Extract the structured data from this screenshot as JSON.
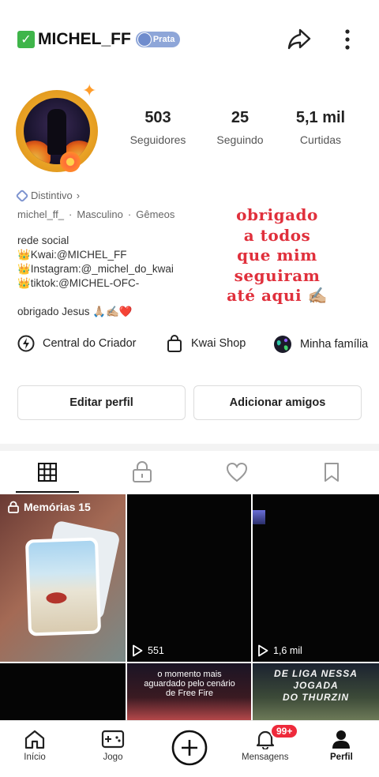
{
  "header": {
    "username": "MICHEL_FF",
    "badge_label": "Prata",
    "share_icon": "share-icon",
    "more_icon": "more-vertical-icon"
  },
  "stats": [
    {
      "value": "503",
      "label": "Seguidores"
    },
    {
      "value": "25",
      "label": "Seguindo"
    },
    {
      "value": "5,1 mil",
      "label": "Curtidas"
    }
  ],
  "profile": {
    "distintivo": "Distintivo",
    "handle": "michel_ff_",
    "gender": "Masculino",
    "sign": "Gêmeos",
    "bio": [
      "rede social",
      "👑Kwai:@MICHEL_FF",
      "👑Instagram:@_michel_do_kwai",
      "👑tiktok:@MICHEL-OFC-",
      "",
      "obrigado Jesus 🙏🏼✍🏼❤️"
    ],
    "overlay_lines": [
      "obrigado",
      "a todos",
      "que mim",
      "seguiram",
      "até aqui ✍🏼"
    ]
  },
  "shortcuts": [
    {
      "label": "Central do Criador",
      "icon": "creator-center-icon"
    },
    {
      "label": "Kwai Shop",
      "icon": "shopping-bag-icon"
    },
    {
      "label": "Minha família",
      "icon": "family-globe-icon"
    }
  ],
  "buttons": {
    "edit": "Editar perfil",
    "add_friends": "Adicionar amigos"
  },
  "tabs": [
    {
      "icon": "grid-icon",
      "active": true
    },
    {
      "icon": "lock-icon",
      "active": false
    },
    {
      "icon": "heart-icon",
      "active": false
    },
    {
      "icon": "bookmark-icon",
      "active": false
    }
  ],
  "grid": {
    "memories_label": "Memórias 15",
    "video2_views": "551",
    "video3_views": "1,6 mil",
    "caption5": "o momento mais aguardado pelo cenário de Free Fire",
    "banner6_top": "DE LIGA NESSA JOGADA",
    "banner6_bottom": "DO THURZIN"
  },
  "nav": {
    "home": "Início",
    "game": "Jogo",
    "messages": "Mensagens",
    "profile": "Perfil",
    "badge": "99+"
  },
  "colors": {
    "accent_red": "#e0303c",
    "badge_blue": "#8ea6d8",
    "notif_red": "#ee2a3b"
  }
}
